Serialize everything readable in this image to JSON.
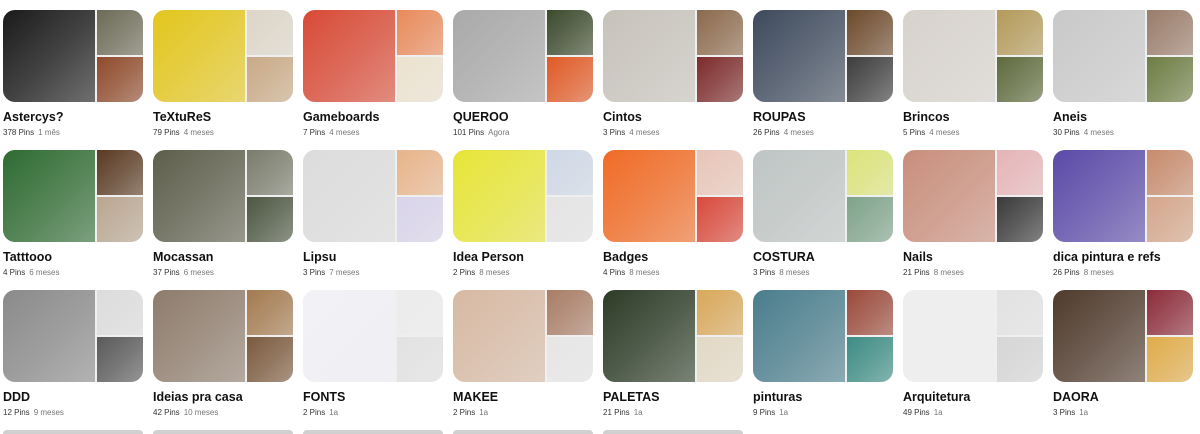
{
  "boards": [
    {
      "name": "Astercys?",
      "pins": "378 Pins",
      "updated": "1 mês",
      "colors": [
        "#1a1a1a",
        "#6d6b57",
        "#8f4a2b"
      ]
    },
    {
      "name": "TeXtuReS",
      "pins": "79 Pins",
      "updated": "4 meses",
      "colors": [
        "#e3c61d",
        "#ddd6c8",
        "#c9aa86"
      ]
    },
    {
      "name": "Gameboards",
      "pins": "7 Pins",
      "updated": "4 meses",
      "colors": [
        "#d84a36",
        "#e98a5a",
        "#ece2cf"
      ]
    },
    {
      "name": "QUEROO",
      "pins": "101 Pins",
      "updated": "Agora",
      "colors": [
        "#a9a9a9",
        "#3b4a2c",
        "#e05a26"
      ]
    },
    {
      "name": "Cintos",
      "pins": "3 Pins",
      "updated": "4 meses",
      "colors": [
        "#c7c3bb",
        "#8c6a4c",
        "#7d2b2b"
      ]
    },
    {
      "name": "ROUPAS",
      "pins": "26 Pins",
      "updated": "4 meses",
      "colors": [
        "#3e4a5c",
        "#6d4a2b",
        "#3d3d3d"
      ]
    },
    {
      "name": "Brincos",
      "pins": "5 Pins",
      "updated": "4 meses",
      "colors": [
        "#d7d2cc",
        "#b49a5a",
        "#5e6a3c"
      ]
    },
    {
      "name": "Aneis",
      "pins": "30 Pins",
      "updated": "4 meses",
      "colors": [
        "#c9c9c9",
        "#9a7c6a",
        "#6e7d43"
      ]
    },
    {
      "name": "Tatttooo",
      "pins": "4 Pins",
      "updated": "6 meses",
      "colors": [
        "#2f6b32",
        "#5a3a22",
        "#b9a690"
      ]
    },
    {
      "name": "Mocassan",
      "pins": "37 Pins",
      "updated": "6 meses",
      "colors": [
        "#5d5e4b",
        "#7a7c6c",
        "#4d5742"
      ]
    },
    {
      "name": "Lipsu",
      "pins": "3 Pins",
      "updated": "7 meses",
      "colors": [
        "#dcdcdc",
        "#e8b48a",
        "#d9d4ea"
      ]
    },
    {
      "name": "Idea Person",
      "pins": "2 Pins",
      "updated": "8 meses",
      "colors": [
        "#e7e537",
        "#cfd8e6",
        "#e4e4e4"
      ]
    },
    {
      "name": "Badges",
      "pins": "4 Pins",
      "updated": "8 meses",
      "colors": [
        "#f06b25",
        "#e8c5b8",
        "#d94a3c"
      ]
    },
    {
      "name": "COSTURA",
      "pins": "3 Pins",
      "updated": "8 meses",
      "colors": [
        "#bfc5c4",
        "#dbe47a",
        "#7fa38a"
      ]
    },
    {
      "name": "Nails",
      "pins": "21 Pins",
      "updated": "8 meses",
      "colors": [
        "#c98e7c",
        "#e6b4b7",
        "#3a3a3a"
      ]
    },
    {
      "name": "dica pintura e refs",
      "pins": "26 Pins",
      "updated": "8 meses",
      "colors": [
        "#5b4aa8",
        "#c78b6c",
        "#d4a68a"
      ]
    },
    {
      "name": "DDD",
      "pins": "12 Pins",
      "updated": "9 meses",
      "colors": [
        "#8a8a8a",
        "#dcdcdc",
        "#5a5a5a"
      ]
    },
    {
      "name": "Ideias pra casa",
      "pins": "42 Pins",
      "updated": "10 meses",
      "colors": [
        "#8e7c6c",
        "#a47a4f",
        "#7b5a3d"
      ]
    },
    {
      "name": "FONTS",
      "pins": "2 Pins",
      "updated": "1a",
      "colors": [
        "#f1f1f6",
        "#ececec",
        "#e2e2e2"
      ]
    },
    {
      "name": "MAKEE",
      "pins": "2 Pins",
      "updated": "1a",
      "colors": [
        "#d7b9a3",
        "#a97d66",
        "#e6e6e6"
      ]
    },
    {
      "name": "PALETAS",
      "pins": "21 Pins",
      "updated": "1a",
      "colors": [
        "#2c3b26",
        "#d9a85a",
        "#e2d8c4"
      ]
    },
    {
      "name": "pinturas",
      "pins": "9 Pins",
      "updated": "1a",
      "colors": [
        "#4a7d8c",
        "#9a4a3a",
        "#3d8c84"
      ]
    },
    {
      "name": "Arquitetura",
      "pins": "49 Pins",
      "updated": "1a",
      "colors": [
        "#eeeeee",
        "#e2e2e2",
        "#d6d6d6"
      ]
    },
    {
      "name": "DAORA",
      "pins": "3 Pins",
      "updated": "1a",
      "colors": [
        "#4f3a2c",
        "#8c2c3a",
        "#e0ac4a"
      ]
    }
  ]
}
